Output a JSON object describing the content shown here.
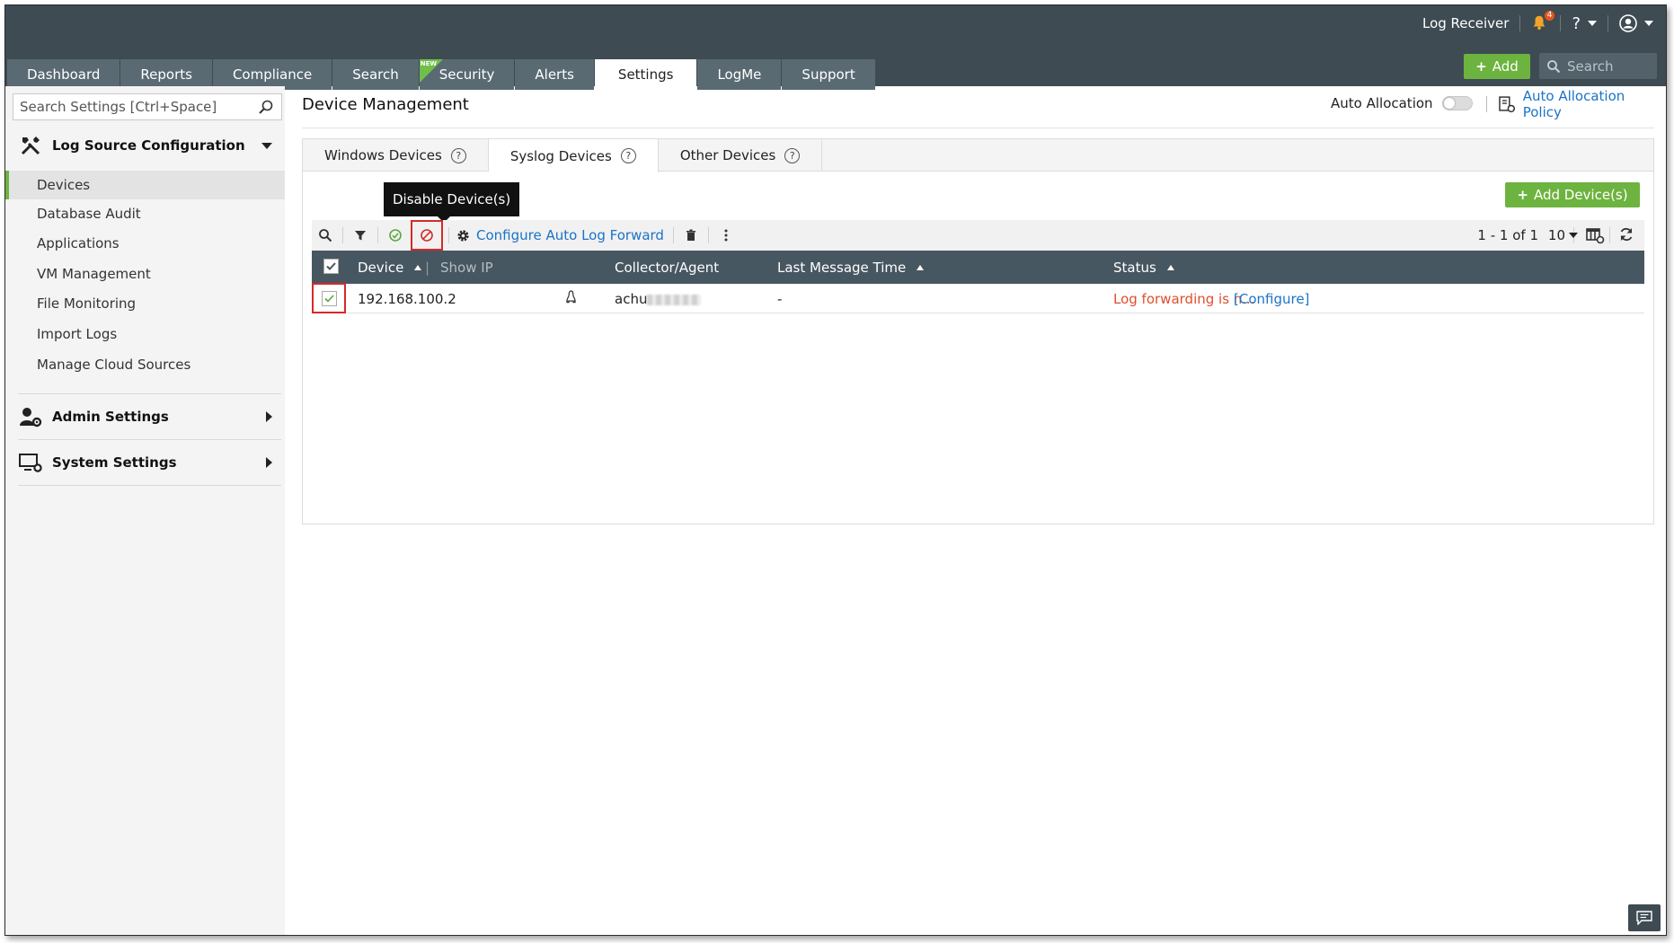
{
  "topbar": {
    "product": "Log Receiver",
    "notification_count": "4",
    "help_label": "?",
    "add_label": "Add",
    "search_placeholder": "Search"
  },
  "nav": {
    "tabs": [
      {
        "label": "Dashboard"
      },
      {
        "label": "Reports"
      },
      {
        "label": "Compliance"
      },
      {
        "label": "Search"
      },
      {
        "label": "Security",
        "badge": "NEW"
      },
      {
        "label": "Alerts"
      },
      {
        "label": "Settings",
        "active": true
      },
      {
        "label": "LogMe"
      },
      {
        "label": "Support"
      }
    ]
  },
  "sidebar": {
    "search_placeholder": "Search Settings [Ctrl+Space]",
    "sections": [
      {
        "label": "Log Source Configuration",
        "expanded": true,
        "items": [
          {
            "label": "Devices",
            "active": true
          },
          {
            "label": "Database Audit"
          },
          {
            "label": "Applications"
          },
          {
            "label": "VM Management"
          },
          {
            "label": "File Monitoring"
          },
          {
            "label": "Import Logs"
          },
          {
            "label": "Manage Cloud Sources"
          }
        ]
      },
      {
        "label": "Admin Settings",
        "expanded": false
      },
      {
        "label": "System Settings",
        "expanded": false
      }
    ]
  },
  "main": {
    "title": "Device Management",
    "auto_allocation_label": "Auto Allocation",
    "auto_allocation_on": false,
    "auto_allocation_policy": "Auto Allocation Policy",
    "tabs": [
      {
        "label": "Windows Devices"
      },
      {
        "label": "Syslog Devices",
        "active": true
      },
      {
        "label": "Other Devices"
      }
    ],
    "add_devices_label": "Add Device(s)",
    "tooltip": "Disable Device(s)",
    "toolbar": {
      "configure_forward": "Configure Auto Log Forward",
      "pager": "1 - 1 of 1",
      "per_page": "10"
    },
    "table": {
      "columns": {
        "device": "Device",
        "show_ip": "Show IP",
        "collector": "Collector/Agent",
        "last_message": "Last Message Time",
        "status": "Status"
      },
      "rows": [
        {
          "device": "192.168.100.2",
          "os_icon": "linux-icon",
          "collector": "achu",
          "last_message": "-",
          "status": "Log forwarding is n...",
          "action": "[Configure]"
        }
      ]
    }
  },
  "colors": {
    "topbar": "#3e4b53",
    "accent_green": "#6db33f",
    "link_blue": "#1a73c9",
    "status_red": "#e04e2b",
    "highlight_red": "#d42a2a"
  }
}
